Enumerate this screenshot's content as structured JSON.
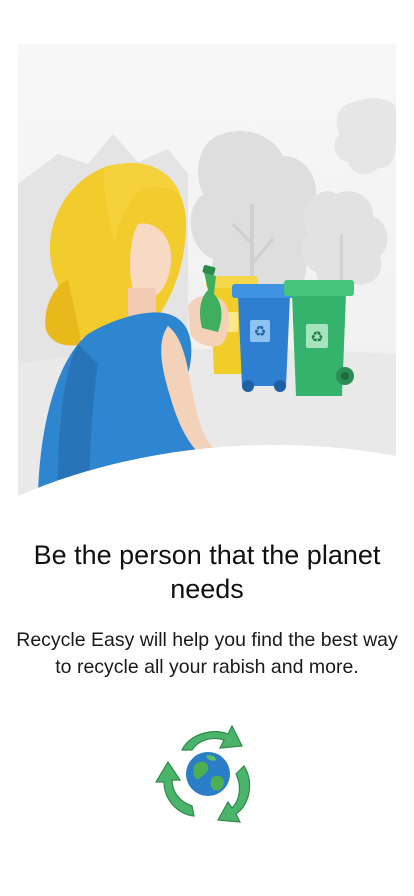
{
  "onboarding": {
    "hero_illustration": "woman-recycling-bottle-illustration",
    "headline": "Be the person that the planet needs",
    "subtitle": "Recycle Easy will help you find the best way to recycle all your rabish and more.",
    "logo_icon": "recycle-earth-icon"
  },
  "colors": {
    "bin_yellow": "#f1cd2a",
    "bin_blue": "#2f7fd0",
    "bin_green": "#35b26b",
    "shirt_blue": "#2f86d0",
    "hair_yellow": "#f2cb2c",
    "arrow_green": "#4ab56a",
    "earth_blue": "#2a7ec8"
  }
}
